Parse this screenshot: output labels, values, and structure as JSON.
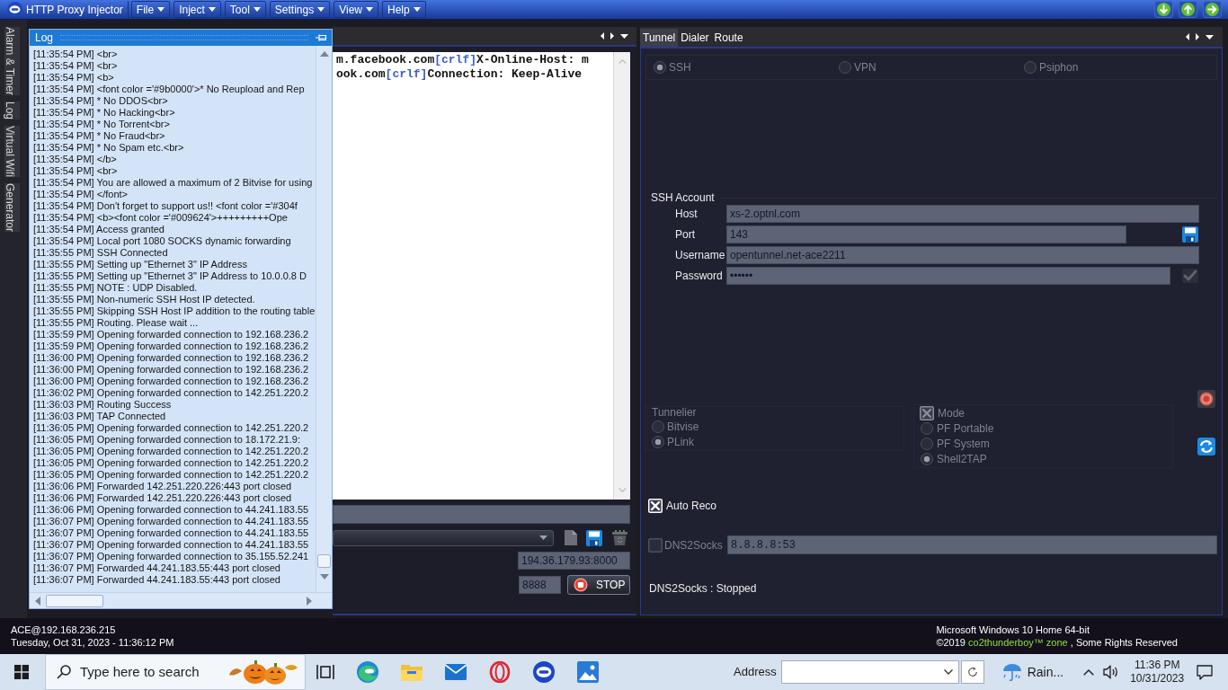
{
  "app": {
    "title": "HTTP Proxy Injector",
    "menus": [
      {
        "label": "File"
      },
      {
        "label": "Inject"
      },
      {
        "label": "Tool"
      },
      {
        "label": "Settings"
      },
      {
        "label": "View"
      },
      {
        "label": "Help"
      }
    ]
  },
  "side_tabs": [
    {
      "label": "Alarm & Timer"
    },
    {
      "label": "Log"
    },
    {
      "label": "Virtual Wifi"
    },
    {
      "label": "Generator"
    }
  ],
  "log_panel": {
    "title": "Log",
    "lines": [
      "[11:35:54 PM] <br>",
      "[11:35:54 PM] <br>",
      "[11:35:54 PM] <b>",
      "[11:35:54 PM] <font color ='#9b0000'>* No Reupload and Rep",
      "[11:35:54 PM] * No DDOS<br>",
      "[11:35:54 PM] * No Hacking<br>",
      "[11:35:54 PM] * No Torrent<br>",
      "[11:35:54 PM] * No Fraud<br>",
      "[11:35:54 PM] * No Spam etc.<br>",
      "[11:35:54 PM] </b>",
      "[11:35:54 PM] <br>",
      "[11:35:54 PM] You are allowed a maximum of 2 Bitvise for using",
      "[11:35:54 PM] </font>",
      "[11:35:54 PM] Don't forget to support us!! <font color ='#304f",
      "[11:35:54 PM] <b><font color ='#009624'>+++++++++Ope",
      "[11:35:54 PM] Access granted",
      "[11:35:54 PM] Local port 1080 SOCKS dynamic forwarding",
      "[11:35:55 PM] SSH Connected",
      "[11:35:55 PM] Setting up \"Ethernet 3\" IP Address",
      "[11:35:55 PM] Setting up \"Ethernet 3\" IP Address to 10.0.0.8 D",
      "[11:35:55 PM] NOTE : UDP Disabled.",
      "[11:35:55 PM] Non-numeric SSH Host IP detected.",
      "[11:35:55 PM] Skipping SSH Host IP addition to the routing table",
      "[11:35:55 PM] Routing. Please wait ...",
      "[11:35:59 PM] Opening forwarded connection to 192.168.236.2",
      "[11:35:59 PM] Opening forwarded connection to 192.168.236.2",
      "[11:36:00 PM] Opening forwarded connection to 192.168.236.2",
      "[11:36:00 PM] Opening forwarded connection to 192.168.236.2",
      "[11:36:00 PM] Opening forwarded connection to 192.168.236.2",
      "[11:36:02 PM] Opening forwarded connection to 142.251.220.2",
      "[11:36:03 PM] Routing Success",
      "[11:36:03 PM] TAP Connected",
      "[11:36:05 PM] Opening forwarded connection to 142.251.220.2",
      "[11:36:05 PM] Opening forwarded connection to 18.172.21.9:",
      "[11:36:05 PM] Opening forwarded connection to 142.251.220.2",
      "[11:36:05 PM] Opening forwarded connection to 142.251.220.2",
      "[11:36:05 PM] Opening forwarded connection to 142.251.220.2",
      "[11:36:06 PM] Forwarded 142.251.220.226:443 port closed",
      "[11:36:06 PM] Forwarded 142.251.220.226:443 port closed",
      "[11:36:06 PM] Opening forwarded connection to 44.241.183.55",
      "[11:36:07 PM] Opening forwarded connection to 44.241.183.55",
      "[11:36:07 PM] Opening forwarded connection to 44.241.183.55",
      "[11:36:07 PM] Opening forwarded connection to 44.241.183.55",
      "[11:36:07 PM] Opening forwarded connection to 35.155.52.241",
      "[11:36:07 PM] Forwarded 44.241.183.55:443 port closed",
      "[11:36:07 PM] Forwarded 44.241.183.55:443 port closed"
    ]
  },
  "payload_editor": {
    "lines": [
      [
        {
          "kind": "text",
          "text": "m.facebook.com"
        },
        {
          "kind": "token",
          "text": "[crlf]"
        },
        {
          "kind": "text",
          "text": "X-Online-Host: m"
        }
      ],
      [
        {
          "kind": "text",
          "text": "ook.com"
        },
        {
          "kind": "token",
          "text": "[crlf]"
        },
        {
          "kind": "text",
          "text": "Connection: Keep-Alive"
        }
      ]
    ]
  },
  "proxy": {
    "server": "194.36.179.93:8000",
    "local_port": "8888",
    "button": "STOP"
  },
  "tunnel_panel": {
    "tabs": [
      {
        "label": "Tunnel",
        "selected": true
      },
      {
        "label": "Dialer",
        "selected": false
      },
      {
        "label": "Route",
        "selected": false
      }
    ],
    "protocol": {
      "disabled": true,
      "options": [
        {
          "label": "SSH",
          "selected": true
        },
        {
          "label": "VPN",
          "selected": false
        },
        {
          "label": "Psiphon",
          "selected": false
        }
      ]
    },
    "ssh_account": {
      "title": "SSH Account",
      "fields": [
        {
          "kind": "text",
          "label": "Host",
          "value": "xs-2.optnl.com"
        },
        {
          "kind": "port",
          "label": "Port",
          "value": "143"
        },
        {
          "kind": "text",
          "label": "Username",
          "value": "opentunnel.net-ace2211"
        },
        {
          "kind": "password",
          "label": "Password",
          "value": "••••••"
        }
      ]
    },
    "tunnelier": {
      "title": "Tunnelier",
      "disabled": true,
      "options": [
        {
          "label": "Bitvise",
          "selected": false
        },
        {
          "label": "PLink",
          "selected": true
        }
      ]
    },
    "mode": {
      "label": "Mode",
      "checked": true,
      "disabled": true,
      "options": [
        {
          "label": "PF Portable",
          "selected": false
        },
        {
          "label": "PF System",
          "selected": false
        },
        {
          "label": "Shell2TAP",
          "selected": true
        }
      ]
    },
    "auto_reco": {
      "label": "Auto Reco",
      "checked": true,
      "disabled": false
    },
    "dns2socks": {
      "label": "DNS2Socks",
      "checked": false,
      "disabled": true,
      "value": "8.8.8.8:53"
    },
    "status": "DNS2Socks : Stopped"
  },
  "info_bar": {
    "user": "ACE@192.168.236.215",
    "datetime": "Tuesday, Oct 31, 2023 - 11:36:12 PM",
    "os": "Microsoft Windows 10 Home 64-bit",
    "copyright": {
      "before": "©2019 ",
      "brand": "co2thunderboy™ zone",
      "after": " , Some Rights Reserved"
    }
  },
  "taskbar": {
    "search": {
      "placeholder": "Type here to search"
    },
    "apps": [
      {
        "kind": "task_view"
      },
      {
        "kind": "browser"
      },
      {
        "kind": "folder"
      },
      {
        "kind": "mail"
      },
      {
        "kind": "ring"
      },
      {
        "kind": "app"
      },
      {
        "kind": "photos"
      }
    ],
    "address_label": "Address",
    "weather": "Rain...",
    "time": "11:36 PM",
    "date": "10/31/2023"
  }
}
